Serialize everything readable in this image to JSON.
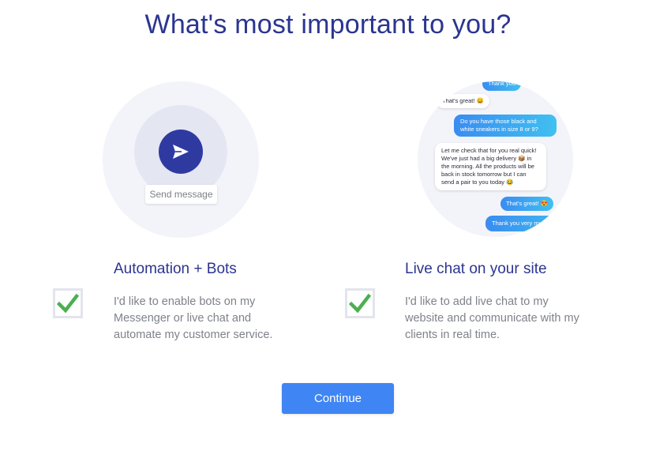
{
  "title": "What's most important to you?",
  "colors": {
    "accent": "#2b3590",
    "button": "#3f85f4",
    "check": "#4caf50",
    "bubble_blue": "#3a8cf0"
  },
  "automation": {
    "illustration_label": "Send message",
    "title": "Automation + Bots",
    "description_lines": [
      "I'd like to enable bots on my",
      "Messenger or live chat and",
      "automate my customer service."
    ],
    "checked": true,
    "icon": "send-icon"
  },
  "livechat": {
    "title": "Live chat on your site",
    "description_lines": [
      "I'd like to add live chat to my",
      "website and communicate with my",
      "clients in real time."
    ],
    "checked": true,
    "chat": [
      "Thank you",
      "That's great! 😀",
      "Do you have those black and white sneakers in size 8 or 9?",
      "Let me check that for you real quick! We've just had a big delivery 📦 in the morning. All the products will be back in stock tomorrow but I can send a pair to you today 😂",
      "That's great! 😍",
      "Thank you very much"
    ]
  },
  "continue_label": "Continue"
}
